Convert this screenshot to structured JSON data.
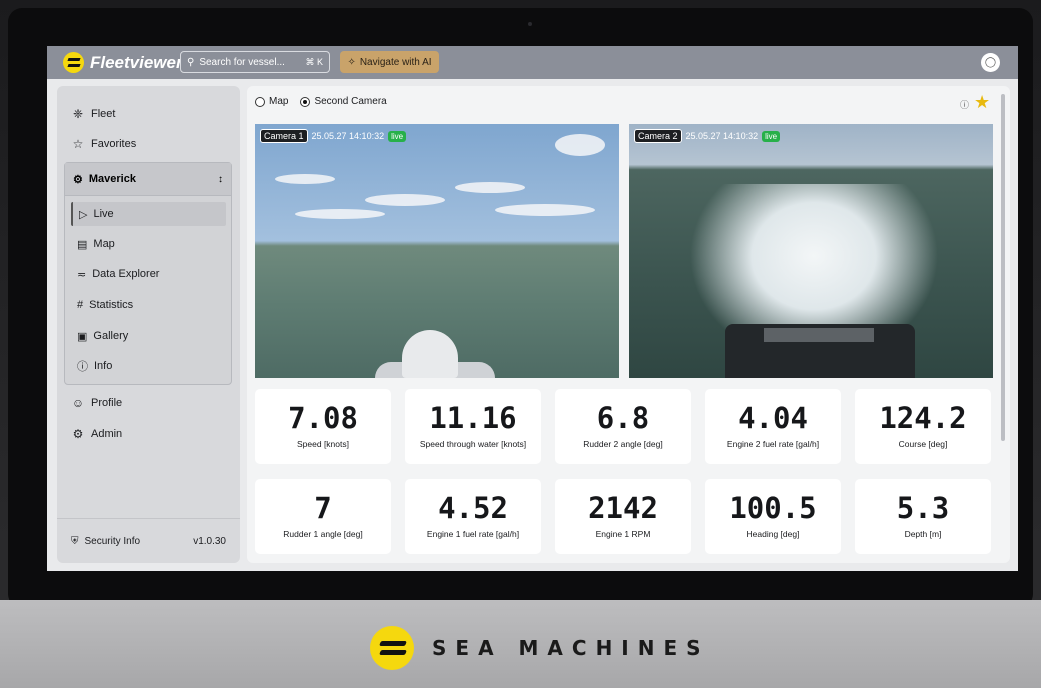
{
  "brand": {
    "name": "SEA MACHINES"
  },
  "topbar": {
    "app_name": "Fleetviewer",
    "search_placeholder": "Search for vessel...",
    "search_shortcut": "⌘ K",
    "ai_button": "Navigate with AI"
  },
  "sidebar": {
    "fleet": "Fleet",
    "favorites": "Favorites",
    "vessel": "Maverick",
    "sub_items": [
      {
        "label": "Live",
        "icon": "play-outline-icon"
      },
      {
        "label": "Map",
        "icon": "map-icon"
      },
      {
        "label": "Data Explorer",
        "icon": "chart-line-icon"
      },
      {
        "label": "Statistics",
        "icon": "hash-icon"
      },
      {
        "label": "Gallery",
        "icon": "gallery-icon"
      },
      {
        "label": "Info",
        "icon": "info-icon"
      }
    ],
    "profile": "Profile",
    "admin": "Admin",
    "security": "Security Info",
    "version": "v1.0.30"
  },
  "view": {
    "option_map": "Map",
    "option_camera": "Second Camera",
    "selected": "Second Camera"
  },
  "cameras": [
    {
      "name": "Camera 1",
      "timestamp": "25.05.27 14:10:32",
      "status": "live"
    },
    {
      "name": "Camera 2",
      "timestamp": "25.05.27 14:10:32",
      "status": "live"
    }
  ],
  "metrics": [
    {
      "value": "7.08",
      "label": "Speed [knots]"
    },
    {
      "value": "11.16",
      "label": "Speed through water [knots]"
    },
    {
      "value": "6.8",
      "label": "Rudder 2 angle [deg]"
    },
    {
      "value": "4.04",
      "label": "Engine 2 fuel rate [gal/h]"
    },
    {
      "value": "124.2",
      "label": "Course [deg]"
    },
    {
      "value": "7",
      "label": "Rudder 1 angle [deg]"
    },
    {
      "value": "4.52",
      "label": "Engine 1 fuel rate [gal/h]"
    },
    {
      "value": "2142",
      "label": "Engine 1 RPM"
    },
    {
      "value": "100.5",
      "label": "Heading [deg]"
    },
    {
      "value": "5.3",
      "label": "Depth [m]"
    }
  ],
  "colors": {
    "accent": "#f5d80e",
    "live": "#27b04a",
    "star": "#e8b90f"
  }
}
